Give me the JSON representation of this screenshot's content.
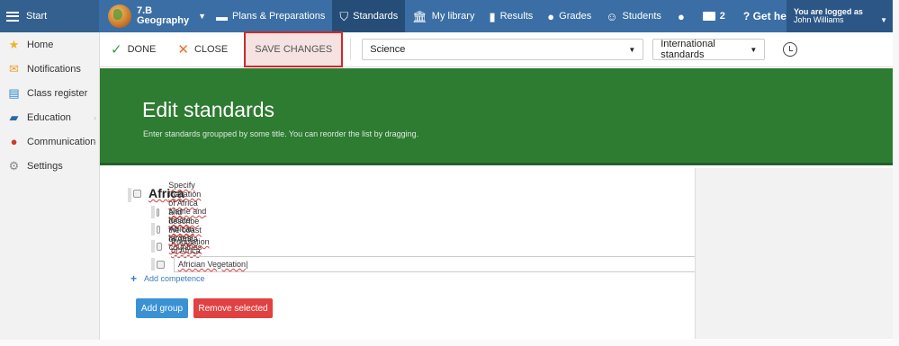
{
  "topbar": {
    "start_label": "Start",
    "class_name": "7.B",
    "subject": "Geography",
    "nav": [
      {
        "label": "Plans & Preparations",
        "icon": "plans-icon"
      },
      {
        "label": "Standards",
        "icon": "shield-icon",
        "active": true
      },
      {
        "label": "My library",
        "icon": "library-icon"
      },
      {
        "label": "Results",
        "icon": "bar-chart-icon"
      },
      {
        "label": "Grades",
        "icon": "grades-icon"
      },
      {
        "label": "Students",
        "icon": "students-icon"
      }
    ],
    "messages_count": "2",
    "help_label": "Get help",
    "login_label": "You are logged as",
    "user_name": "John Williams"
  },
  "sidebar": {
    "items": [
      {
        "label": "Home",
        "icon": "star-icon"
      },
      {
        "label": "Notifications",
        "icon": "envelope-icon"
      },
      {
        "label": "Class register",
        "icon": "register-icon"
      },
      {
        "label": "Education",
        "icon": "education-icon",
        "has_submenu": true
      },
      {
        "label": "Communication",
        "icon": "chat-icon",
        "has_submenu": true
      },
      {
        "label": "Settings",
        "icon": "gear-icon"
      }
    ]
  },
  "toolbar": {
    "done_label": "DONE",
    "close_label": "CLOSE",
    "save_label": "SAVE CHANGES",
    "subject_value": "Science",
    "standards_value": "International standards"
  },
  "banner": {
    "title": "Edit standards",
    "subtitle": "Enter standards groupped by some title. You can reorder the list by dragging."
  },
  "editor": {
    "group_title": "Africa",
    "competences": [
      "Specify loacation of Africa and describe the coast of Africa",
      "Name and locate African largest countries",
      "Population of Africa",
      "Africian Vegetation"
    ],
    "add_competence_label": "Add competence",
    "add_group_label": "Add group",
    "remove_selected_label": "Remove selected"
  },
  "colors": {
    "topbar": "#3b6ea5",
    "banner": "#2e7b32",
    "save_highlight": "#cc2b2b",
    "add_group_button": "#3a92d4",
    "remove_button": "#e14141"
  }
}
